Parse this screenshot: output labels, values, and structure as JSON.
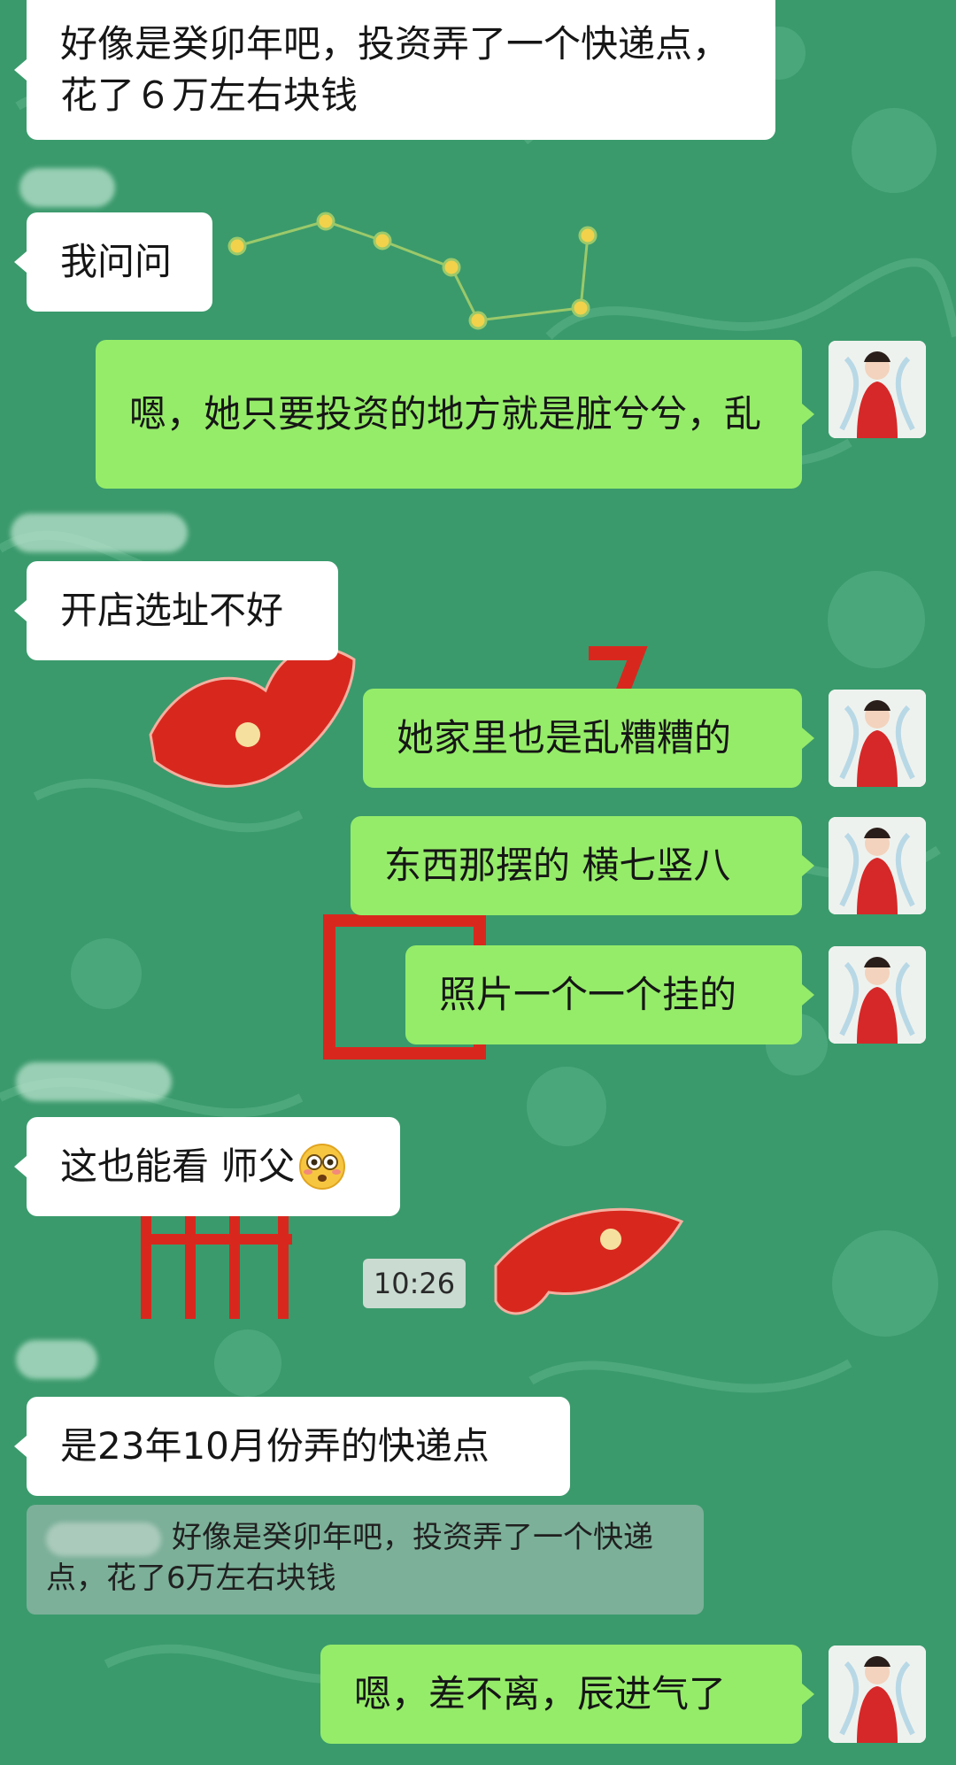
{
  "chat": {
    "messages": [
      {
        "id": "m1",
        "side": "in",
        "text": "好像是癸卯年吧，投资弄了一个快递点，花了６万左右块钱"
      },
      {
        "id": "m2",
        "side": "in",
        "text": "我问问"
      },
      {
        "id": "m3",
        "side": "out",
        "text": "嗯，她只要投资的地方就是脏兮兮，乱"
      },
      {
        "id": "m4",
        "side": "in",
        "text": "开店选址不好"
      },
      {
        "id": "m5",
        "side": "out",
        "text": "她家里也是乱糟糟的"
      },
      {
        "id": "m6",
        "side": "out",
        "text": "东西那摆的 横七竖八"
      },
      {
        "id": "m7",
        "side": "out",
        "text": "照片一个一个挂的"
      },
      {
        "id": "m8",
        "side": "in",
        "text": "这也能看 师父"
      },
      {
        "id": "m9",
        "side": "in",
        "text": "是23年10月份弄的快递点"
      },
      {
        "id": "m10",
        "side": "out",
        "text": "嗯，差不离，辰进气了"
      }
    ],
    "timestamp": "10:26",
    "quote_text": "好像是癸卯年吧，投资弄了一个快递点，花了6万左右块钱",
    "emoji": "flushed-face-emoji"
  },
  "colors": {
    "background": "#3a9a6c",
    "incoming_bubble": "#ffffff",
    "outgoing_bubble": "#95ec69",
    "wallpaper_red": "#d8281e"
  }
}
